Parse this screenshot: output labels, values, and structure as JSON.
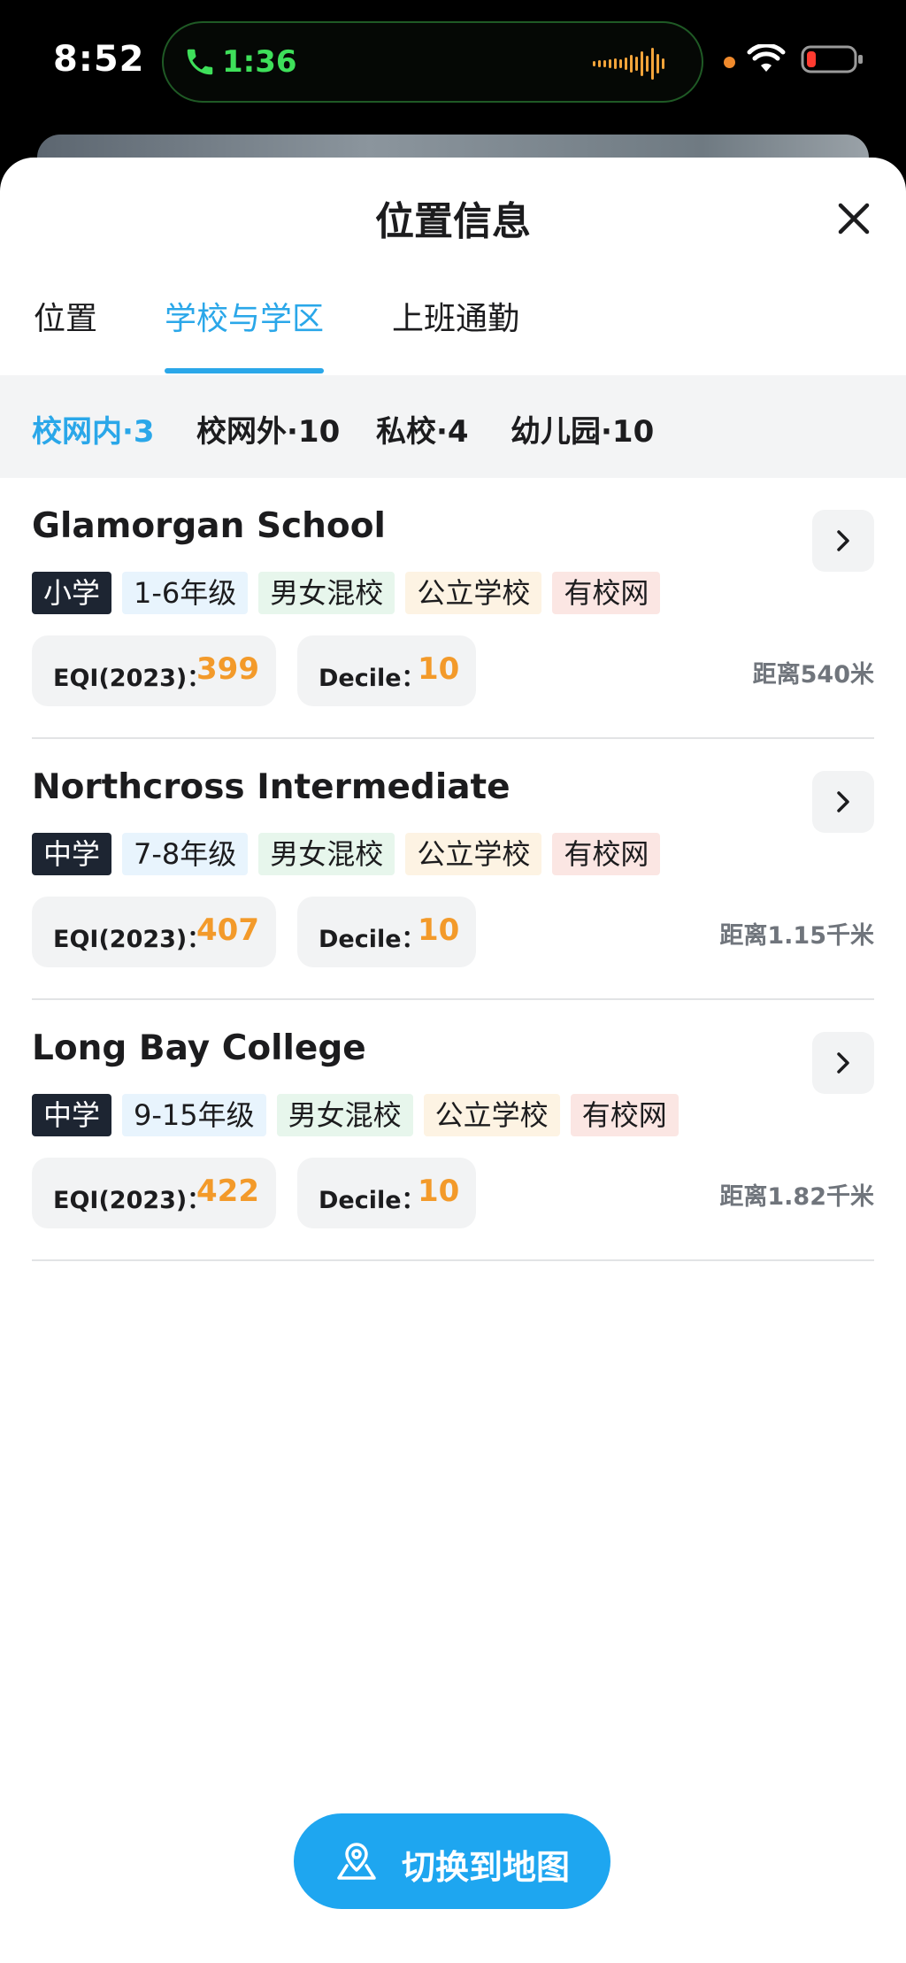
{
  "status_bar": {
    "time": "8:52",
    "call_duration": "1:36"
  },
  "sheet": {
    "title": "位置信息",
    "tabs": [
      {
        "label": "位置"
      },
      {
        "label": "学校与学区"
      },
      {
        "label": "上班通勤"
      }
    ],
    "active_tab": "学校与学区",
    "filters": [
      {
        "label": "校网内·3"
      },
      {
        "label": "校网外·10"
      },
      {
        "label": "私校·4"
      },
      {
        "label": "幼儿园·10"
      }
    ],
    "active_filter": "校网内·3"
  },
  "schools": [
    {
      "name": "Glamorgan School",
      "tags": [
        "小学",
        "1-6年级",
        "男女混校",
        "公立学校",
        "有校网"
      ],
      "eqi_label": "EQI(2023)：",
      "eqi": "399",
      "decile_label": "Decile：",
      "decile": "10",
      "distance": "距离540米"
    },
    {
      "name": "Northcross Intermediate",
      "tags": [
        "中学",
        "7-8年级",
        "男女混校",
        "公立学校",
        "有校网"
      ],
      "eqi_label": "EQI(2023)：",
      "eqi": "407",
      "decile_label": "Decile：",
      "decile": "10",
      "distance": "距离1.15千米"
    },
    {
      "name": "Long Bay College",
      "tags": [
        "中学",
        "9-15年级",
        "男女混校",
        "公立学校",
        "有校网"
      ],
      "eqi_label": "EQI(2023)：",
      "eqi": "422",
      "decile_label": "Decile：",
      "decile": "10",
      "distance": "距离1.82千米"
    }
  ],
  "map_button": {
    "label": "切换到地图",
    "icon": "map-pin-icon"
  },
  "colors": {
    "accent": "#2aa7e9",
    "score": "#f39a2a",
    "button": "#1ea6f0",
    "level_tag": "#1d2532"
  }
}
